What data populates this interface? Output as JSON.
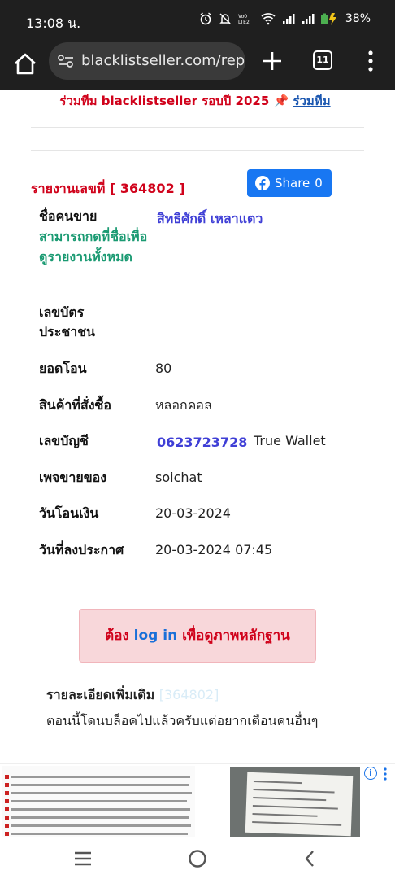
{
  "status_bar": {
    "time": "13:08 น.",
    "battery": "38%",
    "icons": [
      "alarm-icon",
      "mute-icon",
      "volte-icon",
      "wifi-icon",
      "signal-icon",
      "signal-icon",
      "battery-charging-icon"
    ]
  },
  "browser": {
    "url": "blacklistseller.com/rep",
    "tab_count": "11",
    "icons": [
      "home-icon",
      "site-info-icon",
      "plus-icon",
      "tabs-icon",
      "more-vert-icon"
    ]
  },
  "banner": {
    "text": "ร่วมทีม blacklistseller รอบปี 2025",
    "pin": "📌",
    "link": "ร่วมทีม"
  },
  "report": {
    "number_label": "รายงานเลขที่ [ 364802 ]",
    "share_label": "Share",
    "share_count": "0"
  },
  "fields": {
    "seller_name_label": "ชื่อคนขาย",
    "seller_name_hint": "สามารถกดที่ชื่อเพื่อดูรายงานทั้งหมด",
    "seller_name": "สิทธิศักดิ์ เหลาแตว",
    "id_card_label": "เลขบัตรประชาชน",
    "amount_label": "ยอดโอน",
    "amount": "80",
    "product_label": "สินค้าที่สั่งซื้อ",
    "product": "หลอกคอล",
    "account_label": "เลขบัญชี",
    "account": "0623723728",
    "bank": "True Wallet",
    "page_label": "เพจขายของ",
    "page": "soichat",
    "transfer_date_label": "วันโอนเงิน",
    "transfer_date": "20-03-2024",
    "posted_label": "วันที่ลงประกาศ",
    "posted": "20-03-2024 07:45"
  },
  "login_notice": {
    "prefix": "ต้อง",
    "link": "log in",
    "suffix": "เพื่อดูภาพหลักฐาน"
  },
  "details": {
    "title": "รายละเอียดเพิ่มเติม",
    "ref": "[364802]",
    "text": "ตอนนี้โดนบล็อคไปแล้วครับแต่อยากเตือนคนอื่นๆ"
  },
  "colors": {
    "accent_red": "#d0021b",
    "link_blue": "#3f3fd6",
    "hint_green": "#1a9a72",
    "facebook_blue": "#1877f2",
    "notice_bg": "#f8d7da"
  }
}
